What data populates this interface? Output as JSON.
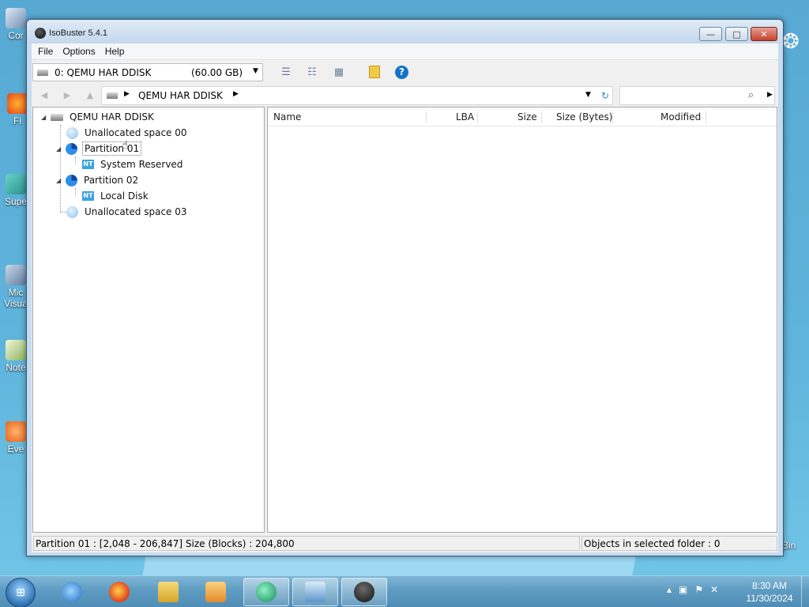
{
  "window": {
    "title": "IsoBuster 5.4.1",
    "min_label": "—",
    "max_label": "□",
    "close_label": "✕"
  },
  "menu": {
    "items": [
      "File",
      "Options",
      "Help"
    ]
  },
  "toolbar": {
    "drive_name": "0: QEMU HAR DDISK",
    "drive_size": "(60.00 GB)",
    "dropdown_arrow": "▼",
    "view_icons": [
      "list-view-icon",
      "details-view-icon",
      "grid-view-icon"
    ],
    "help_label": "?"
  },
  "addressbar": {
    "path": "QEMU HAR DDISK",
    "back": "◀",
    "forward": "▶",
    "up": "▲",
    "sep": "▶",
    "dd": "▼",
    "refresh": "↻",
    "search_icon": "⌕",
    "search_arrow": "▶",
    "search_value": ""
  },
  "tree": {
    "root": "QEMU HAR DDISK",
    "items": [
      {
        "label": "Unallocated space 00",
        "type": "unallocated"
      },
      {
        "label": "Partition 01",
        "type": "partition",
        "selected": true
      },
      {
        "label": "System Reserved",
        "type": "filesystem"
      },
      {
        "label": "Partition 02",
        "type": "partition"
      },
      {
        "label": "Local Disk",
        "type": "filesystem"
      },
      {
        "label": "Unallocated space 03",
        "type": "unallocated"
      }
    ],
    "expander_open": "◢"
  },
  "list": {
    "columns": [
      "Name",
      "LBA",
      "Size",
      "Size (Bytes)",
      "Modified"
    ],
    "rows": []
  },
  "statusbar": {
    "left": "Partition 01 : [2,048 - 206,847]  Size (Blocks) : 204,800",
    "right": "Objects in selected folder : 0"
  },
  "desktop": {
    "icons": [
      "Cor",
      "Fi",
      "Supe",
      "Mic Visua",
      "Note",
      "Eve"
    ],
    "recycle_bin_label": "Bin"
  },
  "taskbar": {
    "start_label": "⊞",
    "time": "8:30 AM",
    "date": "11/30/2024",
    "colors": {
      "accent": "#1473c9"
    }
  }
}
